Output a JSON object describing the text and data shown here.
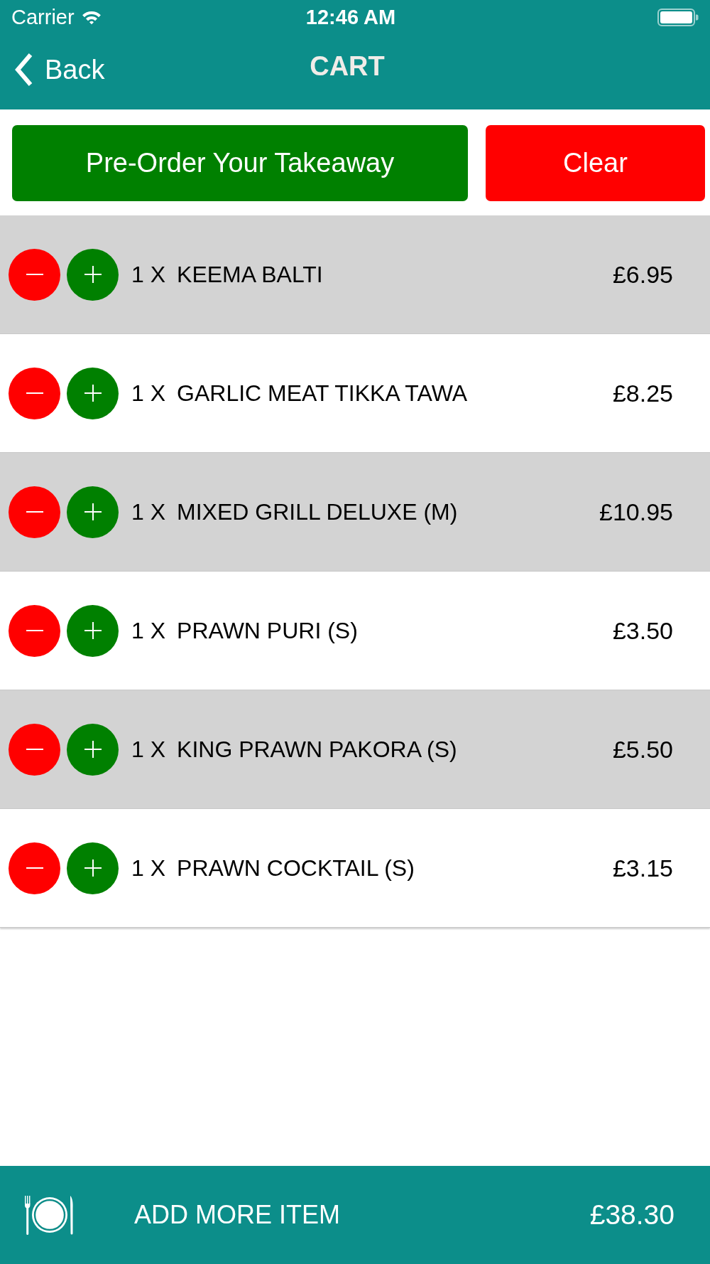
{
  "status_bar": {
    "carrier": "Carrier",
    "time": "12:46 AM"
  },
  "nav_bar": {
    "back_label": "Back",
    "title": "CART"
  },
  "actions": [
    {
      "kind": "primary",
      "label": "Pre-Order Your Takeaway"
    },
    {
      "kind": "danger",
      "label": "Clear"
    }
  ],
  "cart_items": [
    {
      "quantity": "1 X",
      "name": "KEEMA BALTI",
      "price": "£6.95"
    },
    {
      "quantity": "1 X",
      "name": "GARLIC MEAT TIKKA TAWA",
      "price": "£8.25"
    },
    {
      "quantity": "1 X",
      "name": "MIXED GRILL DELUXE (M)",
      "price": "£10.95"
    },
    {
      "quantity": "1 X",
      "name": "PRAWN PURI (S)",
      "price": "£3.50"
    },
    {
      "quantity": "1 X",
      "name": "KING PRAWN PAKORA (S)",
      "price": "£5.50"
    },
    {
      "quantity": "1 X",
      "name": "PRAWN COCKTAIL (S)",
      "price": "£3.15"
    }
  ],
  "footer": {
    "label": "ADD MORE ITEM",
    "total": "£38.30"
  }
}
